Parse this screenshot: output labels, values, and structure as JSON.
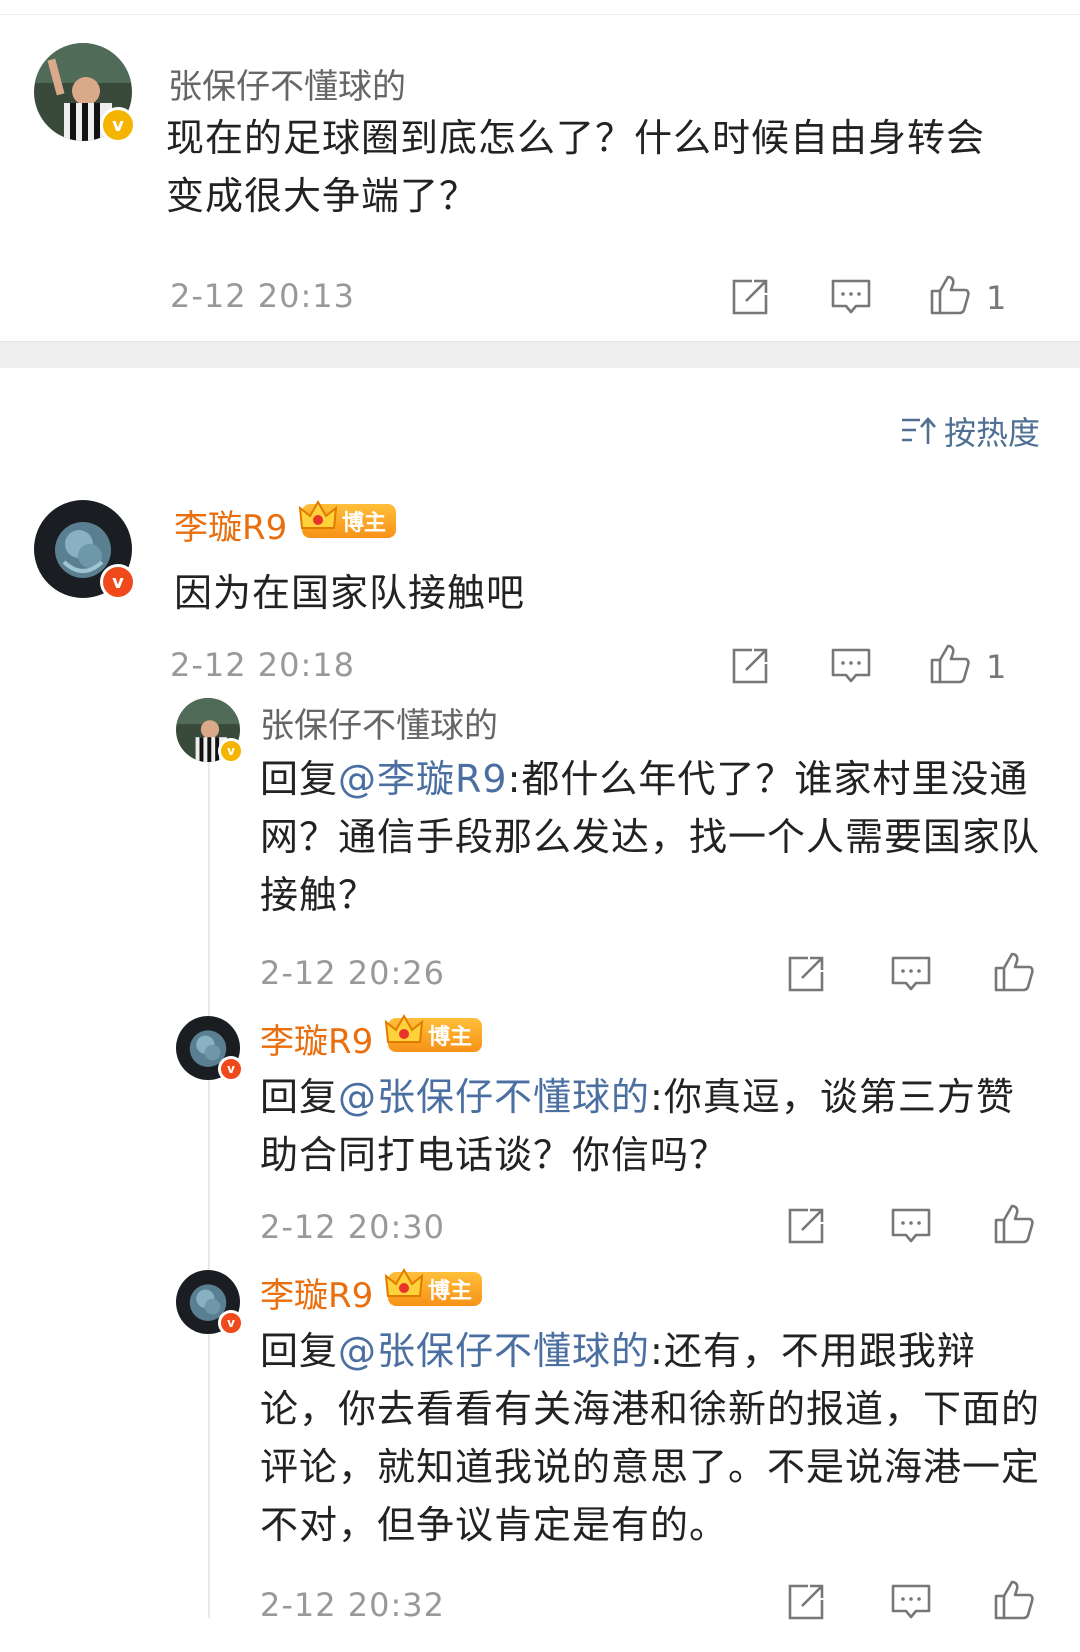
{
  "root": {
    "username": "张保仔不懂球的",
    "text": "现在的足球圈到底怎么了？什么时候自由身转会变成很大争端了？",
    "time": "2-12 20:13",
    "likes": "1"
  },
  "sort_label": "按热度",
  "comment": {
    "username": "李璇R9",
    "badge": "博主",
    "text": "因为在国家队接触吧",
    "time": "2-12 20:18",
    "likes": "1"
  },
  "replies": [
    {
      "username": "张保仔不懂球的",
      "prefix": "回复",
      "mention": "@李璇R9",
      "text": ":都什么年代了？谁家村里没通网？通信手段那么发达，找一个人需要国家队接触？",
      "time": "2-12 20:26"
    },
    {
      "username": "李璇R9",
      "badge": "博主",
      "prefix": "回复",
      "mention": "@张保仔不懂球的",
      "text": ":你真逗，谈第三方赞助合同打电话谈？你信吗？",
      "time": "2-12 20:30"
    },
    {
      "username": "李璇R9",
      "badge": "博主",
      "prefix": "回复",
      "mention": "@张保仔不懂球的",
      "text": ":还有，不用跟我辩论，你去看看有关海港和徐新的报道，下面的评论，就知道我说的意思了。不是说海港一定不对，但争议肯定是有的。",
      "time": "2-12 20:32"
    }
  ],
  "colors": {
    "vip_name": "#e96e0d",
    "mention": "#4a6fa0",
    "sort": "#4f6f93"
  }
}
